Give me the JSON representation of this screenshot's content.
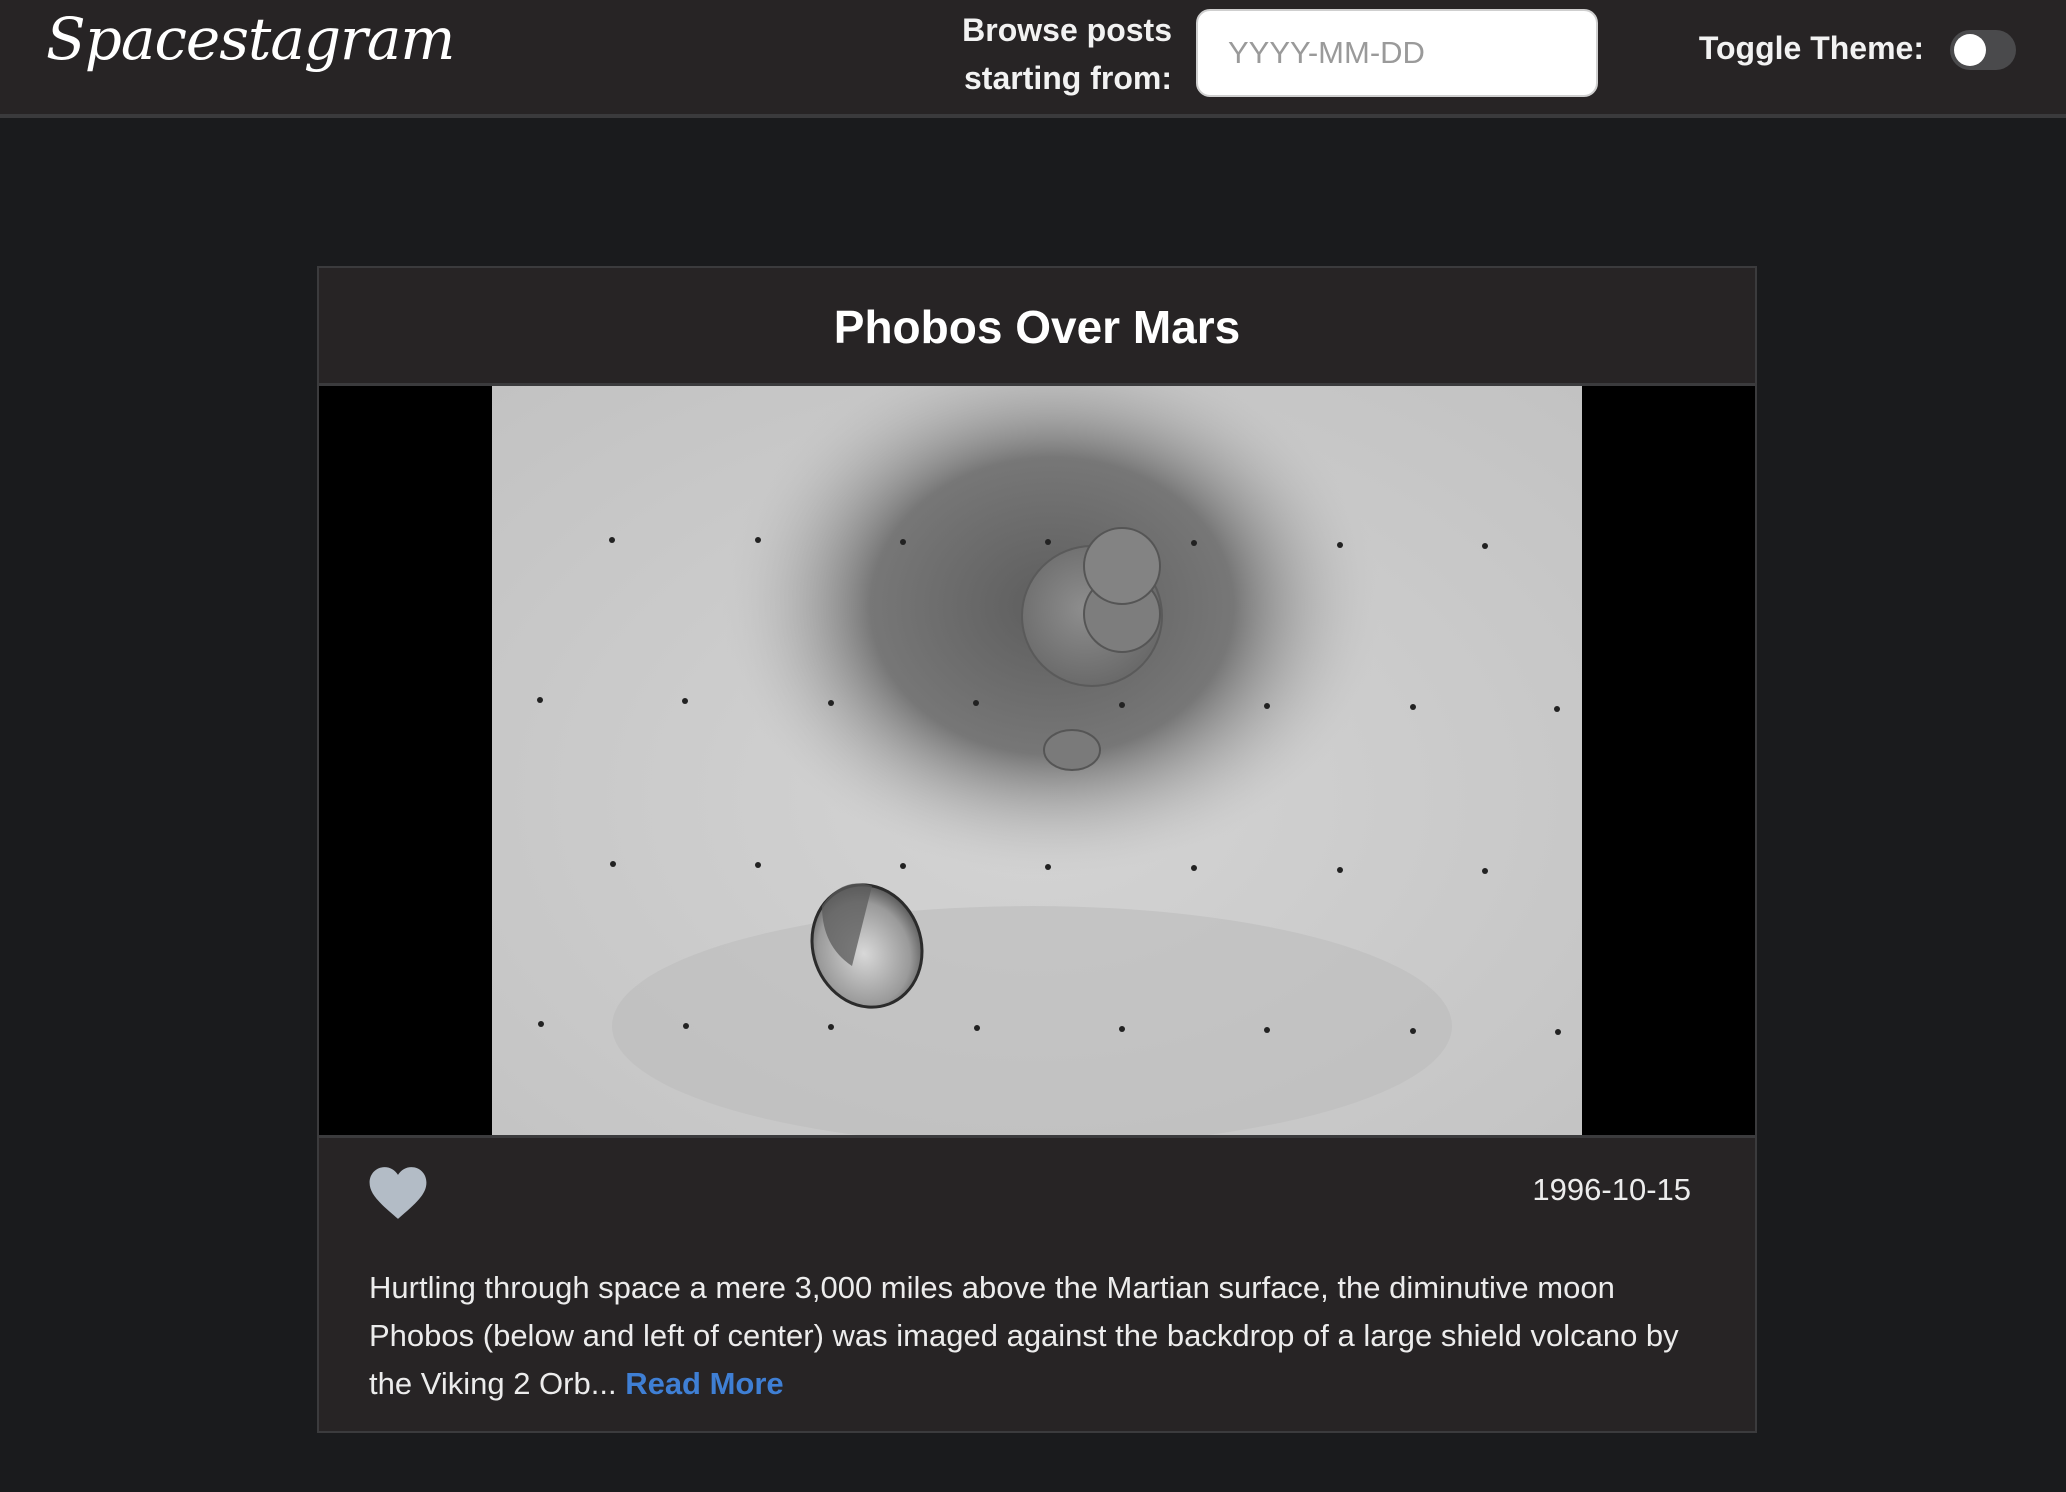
{
  "header": {
    "logo": "Spacestagram",
    "browse_label_line1": "Browse posts",
    "browse_label_line2": "starting from:",
    "date_placeholder": "YYYY-MM-DD",
    "date_value": "",
    "theme_label": "Toggle Theme:",
    "theme_toggle_on": false
  },
  "post": {
    "title": "Phobos Over Mars",
    "date": "1996-10-15",
    "liked": false,
    "like_icon": "heart-icon",
    "description": "Hurtling through space a mere 3,000 miles above the Martian surface, the diminutive moon Phobos (below and left of center) was imaged against the backdrop of a large shield volcano by the Viking 2 Orb...",
    "read_more_label": "Read More"
  },
  "colors": {
    "background": "#1a1b1d",
    "surface": "#272425",
    "accent_link": "#3f7fd4",
    "heart": "#b3bcc6"
  }
}
